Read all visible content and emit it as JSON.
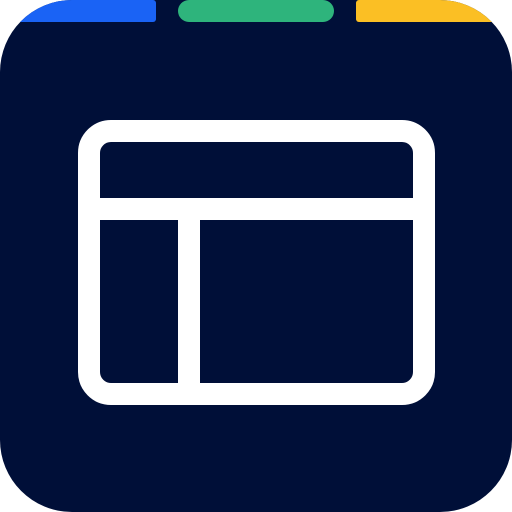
{
  "icon": {
    "name": "layout-icon",
    "background_color": "#000f38",
    "stroke_color": "#ffffff"
  },
  "accent_bars": [
    {
      "name": "accent-bar-blue",
      "color": "#1a63f5"
    },
    {
      "name": "accent-bar-green",
      "color": "#2eb47c"
    },
    {
      "name": "accent-bar-yellow",
      "color": "#fbbf24"
    }
  ]
}
